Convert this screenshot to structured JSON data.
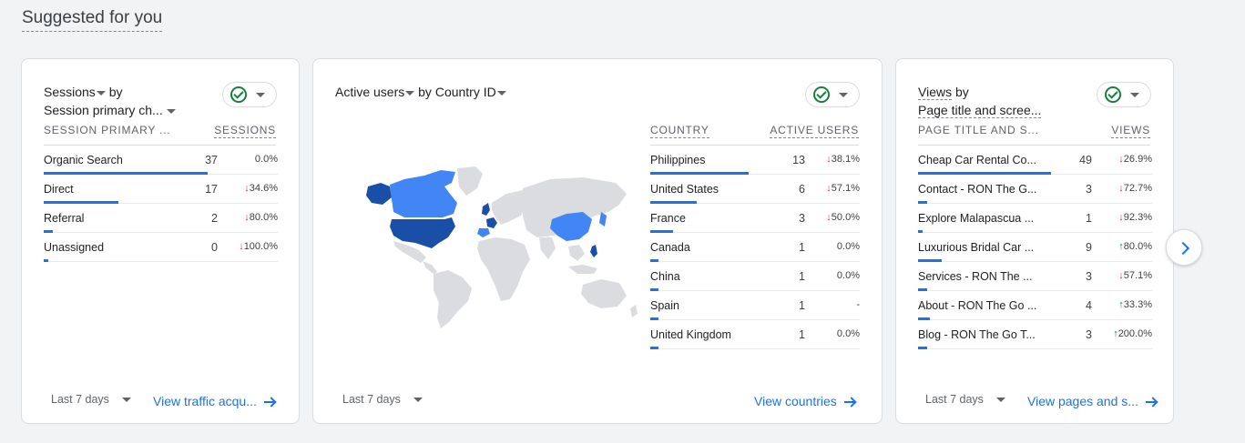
{
  "section_title": "Suggested for you",
  "cards": [
    {
      "title": {
        "metric": "Sessions",
        "by": "by",
        "dimension": "Session primary ch..."
      },
      "columns": [
        "SESSION PRIMARY ...",
        "SESSIONS"
      ],
      "rows": [
        {
          "label": "Organic Search",
          "value": "37",
          "change": "0.0%",
          "dir": "",
          "share": 0.7
        },
        {
          "label": "Direct",
          "value": "17",
          "change": "34.6%",
          "dir": "down",
          "share": 0.32
        },
        {
          "label": "Referral",
          "value": "2",
          "change": "80.0%",
          "dir": "down",
          "share": 0.04
        },
        {
          "label": "Unassigned",
          "value": "0",
          "change": "100.0%",
          "dir": "down",
          "share": 0
        }
      ],
      "date_range": "Last 7 days",
      "link": "View traffic acqu..."
    },
    {
      "title": {
        "metric": "Active users",
        "by": "by",
        "dimension": "Country ID"
      },
      "columns": [
        "COUNTRY",
        "ACTIVE USERS"
      ],
      "rows": [
        {
          "label": "Philippines",
          "value": "13",
          "change": "38.1%",
          "dir": "down",
          "share": 0.47
        },
        {
          "label": "United States",
          "value": "6",
          "change": "57.1%",
          "dir": "down",
          "share": 0.22
        },
        {
          "label": "France",
          "value": "3",
          "change": "50.0%",
          "dir": "down",
          "share": 0.11
        },
        {
          "label": "Canada",
          "value": "1",
          "change": "0.0%",
          "dir": "",
          "share": 0.04
        },
        {
          "label": "China",
          "value": "1",
          "change": "0.0%",
          "dir": "",
          "share": 0.04
        },
        {
          "label": "Spain",
          "value": "1",
          "change": "-",
          "dir": "",
          "share": 0.04
        },
        {
          "label": "United Kingdom",
          "value": "1",
          "change": "0.0%",
          "dir": "",
          "share": 0.04
        }
      ],
      "date_range": "Last 7 days",
      "link": "View countries"
    },
    {
      "title": {
        "metric": "Views",
        "by": "by",
        "dimension": "Page title and scree..."
      },
      "columns": [
        "PAGE TITLE AND S...",
        "VIEWS"
      ],
      "rows": [
        {
          "label": "Cheap Car Rental Co...",
          "value": "49",
          "change": "26.9%",
          "dir": "down",
          "share": 0.57
        },
        {
          "label": "Contact - RON The G...",
          "value": "3",
          "change": "72.7%",
          "dir": "down",
          "share": 0.04
        },
        {
          "label": "Explore Malapascua ...",
          "value": "1",
          "change": "92.3%",
          "dir": "down",
          "share": 0.01
        },
        {
          "label": "Luxurious Bridal Car ...",
          "value": "9",
          "change": "80.0%",
          "dir": "up",
          "share": 0.1
        },
        {
          "label": "Services - RON The ...",
          "value": "3",
          "change": "57.1%",
          "dir": "down",
          "share": 0.04
        },
        {
          "label": "About - RON The Go ...",
          "value": "4",
          "change": "33.3%",
          "dir": "up",
          "share": 0.05
        },
        {
          "label": "Blog - RON The Go T...",
          "value": "3",
          "change": "200.0%",
          "dir": "up",
          "share": 0.04
        }
      ],
      "date_range": "Last 7 days",
      "link": "View pages and s..."
    }
  ],
  "colors": {
    "accent": "#1a73e8",
    "down": "#d93025",
    "up": "#188038",
    "map_dark": "#1a4fa8",
    "map_mid": "#4285f4",
    "map_light": "#8ab4f8",
    "map_none": "#dadce0"
  },
  "icons": {
    "status": "check-circle-icon",
    "next": "chevron-right-icon",
    "arrow": "arrow-right-icon"
  }
}
